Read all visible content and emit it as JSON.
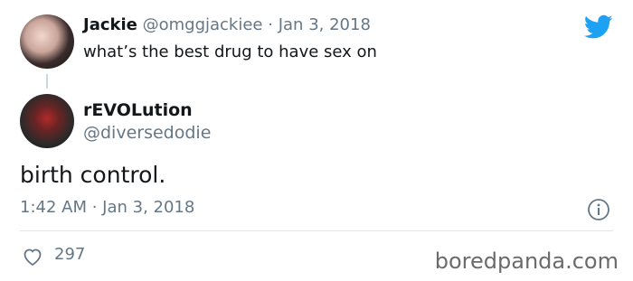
{
  "original_tweet": {
    "author_name": "Jackie",
    "author_handle": "@omggjackiee",
    "separator": "·",
    "date": "Jan 3, 2018",
    "text": "what’s the best drug to have sex on"
  },
  "reply_tweet": {
    "author_name": "rEVOLution",
    "author_handle": "@diversedodie",
    "text": "birth control.",
    "timestamp": "1:42 AM · Jan 3, 2018",
    "like_count": "297"
  },
  "watermark": "boredpanda.com",
  "icons": {
    "brand": "twitter-bird-icon",
    "info": "info-icon",
    "like": "heart-icon"
  },
  "colors": {
    "twitter_blue": "#1da1f2",
    "muted_text": "#657786",
    "primary_text": "#14171a"
  }
}
